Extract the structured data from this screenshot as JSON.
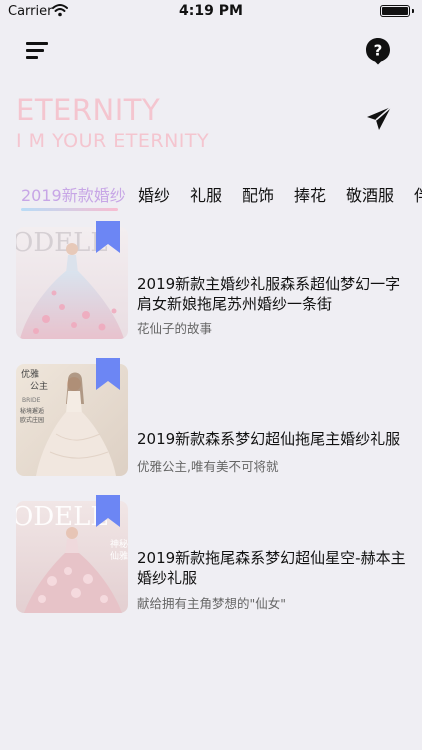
{
  "status_bar": {
    "carrier": "Carrier",
    "time": "4:19 PM"
  },
  "nav": {
    "menu_icon": "menu-icon",
    "help_icon": "help-icon"
  },
  "hero": {
    "title": "ETERNITY",
    "subtitle": "I M YOUR ETERNITY",
    "title_color": "#f4c5cf",
    "send_icon": "paper-plane-icon"
  },
  "tabs": [
    {
      "label": "2019新款婚纱",
      "active": true
    },
    {
      "label": "婚纱",
      "active": false
    },
    {
      "label": "礼服",
      "active": false
    },
    {
      "label": "配饰",
      "active": false
    },
    {
      "label": "捧花",
      "active": false
    },
    {
      "label": "敬酒服",
      "active": false
    },
    {
      "label": "伴",
      "active": false
    }
  ],
  "accent": {
    "tab_active_color": "#c7a6e6",
    "bookmark_color": "#6c86f4"
  },
  "articles": [
    {
      "title": "2019新款主婚纱礼服森系超仙梦幻一字肩女新娘拖尾苏州婚纱一条街",
      "desc": "花仙子的故事"
    },
    {
      "title": "2019新款森系梦幻超仙拖尾主婚纱礼服",
      "desc": "优雅公主,唯有美不可将就",
      "thumb_text": [
        "优雅",
        "公主",
        "BRIDE",
        "秘境邂逅",
        "欧式庄园"
      ]
    },
    {
      "title": "2019新款拖尾森系梦幻超仙星空-赫本主婚纱礼服",
      "desc": "献给拥有主角梦想的\"仙女\"",
      "thumb_text": [
        "神秘",
        "仙雅"
      ]
    }
  ]
}
